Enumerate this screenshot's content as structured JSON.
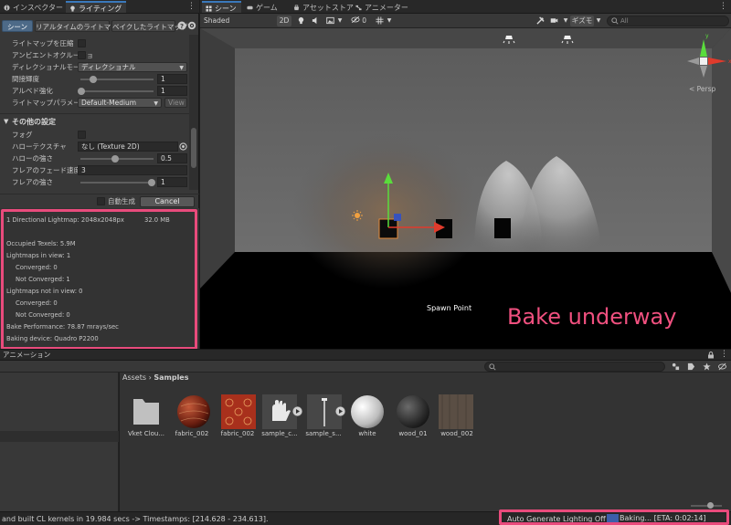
{
  "left_panel": {
    "tabs": [
      {
        "label": "インスペクター",
        "active": false
      },
      {
        "label": "ライティング",
        "active": true
      }
    ],
    "subtabs": [
      {
        "label": "シーン",
        "active": true
      },
      {
        "label": "リアルタイムのライトマップ",
        "active": false
      },
      {
        "label": "ベイクしたライトマップ",
        "active": false
      }
    ],
    "properties": [
      {
        "label": "ライトマップを圧縮",
        "kind": "checkbox"
      },
      {
        "label": "アンビエントオクルージョ",
        "kind": "checkbox"
      },
      {
        "label": "ディレクショナルモード",
        "kind": "dropdown",
        "value": "ディレクショナル"
      },
      {
        "label": "間接輝度",
        "kind": "slider",
        "value": "1",
        "fraction": 0.15
      },
      {
        "label": "アルベド強化",
        "kind": "slider",
        "value": "1",
        "fraction": 0.0
      },
      {
        "label": "ライトマップパラメーター",
        "kind": "dropdown-view",
        "value": "Default-Medium",
        "button": "View"
      }
    ],
    "other_section": {
      "title": "その他の設定",
      "properties": [
        {
          "label": "フォグ",
          "kind": "checkbox"
        },
        {
          "label": "ハローテクスチャ",
          "kind": "object",
          "value": "なし (Texture 2D)"
        },
        {
          "label": "ハローの強さ",
          "kind": "slider",
          "value": "0.5",
          "fraction": 0.5
        },
        {
          "label": "フレアのフェード速度",
          "kind": "number",
          "value": "3"
        },
        {
          "label": "フレアの強さ",
          "kind": "slider",
          "value": "1",
          "fraction": 1.0
        }
      ]
    },
    "auto_generate_label": "自動生成",
    "cancel_label": "Cancel",
    "stats": {
      "lightmap_line": "1 Directional Lightmap: 2048x2048px",
      "lightmap_size": "32.0 MB",
      "occupied": "Occupied Texels: 5.9M",
      "in_view": "Lightmaps in view: 1",
      "in_view_converged": "Converged: 0",
      "in_view_not_converged": "Not Converged: 1",
      "not_in_view": "Lightmaps not in view: 0",
      "not_in_view_converged": "Converged: 0",
      "not_in_view_not_converged": "Not Converged: 0",
      "performance": "Bake Performance: 78.87 mrays/sec",
      "device": "Baking device: Quadro P2200"
    }
  },
  "scene_tabs": [
    {
      "label": "シーン",
      "active": true
    },
    {
      "label": "ゲーム",
      "active": false
    },
    {
      "label": "アセットストア",
      "active": false
    },
    {
      "label": "アニメーター",
      "active": false
    }
  ],
  "scene_toolbar": {
    "shading_mode": "Shaded",
    "mode_2d": "2D",
    "hidden_count": "0",
    "gizmos_label": "ギズモ",
    "search_placeholder": "All"
  },
  "scene": {
    "persp_label": "< Persp",
    "spawn_label": "Spawn Point",
    "caption": "Bake underway"
  },
  "bottom_panel": {
    "tab_label": "アニメーション",
    "breadcrumb_root": "Assets",
    "breadcrumb_sep": "›",
    "breadcrumb_current": "Samples",
    "assets": [
      {
        "name": "Vket Clou...",
        "kind": "folder"
      },
      {
        "name": "fabric_002",
        "kind": "sphere-fabric"
      },
      {
        "name": "fabric_002",
        "kind": "tile-fabric"
      },
      {
        "name": "sample_c...",
        "kind": "glove"
      },
      {
        "name": "sample_s...",
        "kind": "stick"
      },
      {
        "name": "white",
        "kind": "sphere-white"
      },
      {
        "name": "wood_01",
        "kind": "sphere-dark"
      },
      {
        "name": "wood_002",
        "kind": "tile-wood"
      }
    ]
  },
  "status": {
    "message": "and built CL kernels in 19.984 secs -> Timestamps: [214.628 - 234.613].",
    "auto_generate": "Auto Generate Lighting Off",
    "baking": "Baking... [ETA: 0:02:14]",
    "progress": 0.1
  },
  "colors": {
    "highlight": "#e94b7c",
    "accent_blue": "#3a79bb",
    "caption": "#f0507f"
  }
}
